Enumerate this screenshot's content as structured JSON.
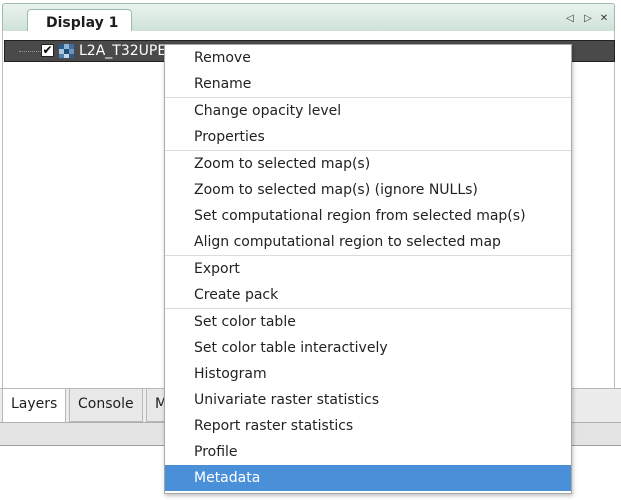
{
  "notebook": {
    "tab_label": "Display 1",
    "controls": [
      "◁",
      "▷",
      "✕"
    ]
  },
  "layer_tree": {
    "layer_name": "L2A_T32UPE",
    "checked": true,
    "checkmark": "✔",
    "icon": "raster-map-icon"
  },
  "bottom_tabs": [
    "Layers",
    "Console",
    "M"
  ],
  "context_menu": {
    "groups": [
      [
        "Remove",
        "Rename"
      ],
      [
        "Change opacity level",
        "Properties"
      ],
      [
        "Zoom to selected map(s)",
        "Zoom to selected map(s) (ignore NULLs)",
        "Set computational region from selected map(s)",
        "Align computational region to selected map"
      ],
      [
        "Export",
        "Create pack"
      ],
      [
        "Set color table",
        "Set color table interactively",
        "Histogram",
        "Univariate raster statistics",
        "Report raster statistics",
        "Profile",
        "Metadata"
      ]
    ],
    "selected_item": "Metadata"
  },
  "colors": {
    "selection": "#4a90d9",
    "layer_row_bg": "#4a4a4a",
    "tab_strip": "#cfe2d8"
  }
}
